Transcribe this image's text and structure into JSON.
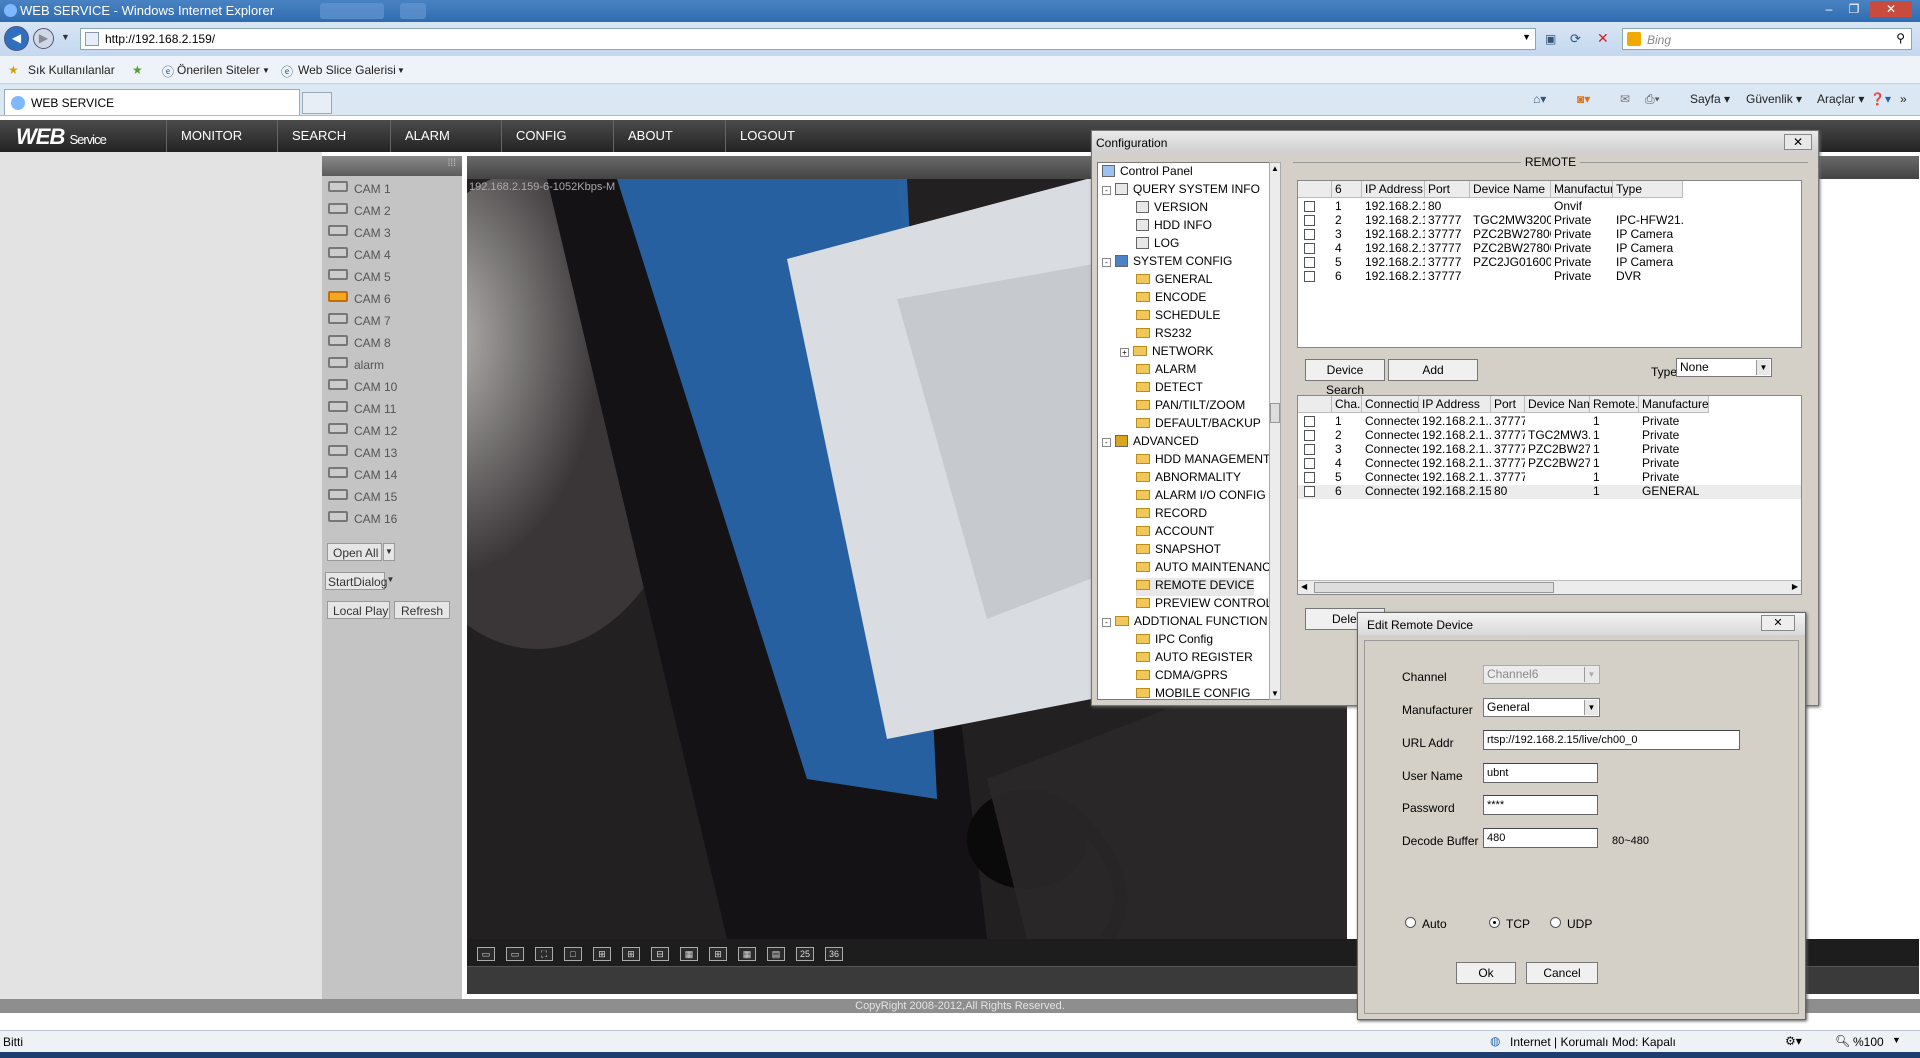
{
  "browser": {
    "window_title": "WEB SERVICE - Windows Internet Explorer",
    "address": "http://192.168.2.159/",
    "search_placeholder": "Bing",
    "favorites": [
      "Sık Kullanılanlar",
      "Önerilen Siteler",
      "Web Slice Galerisi"
    ],
    "tab_title": "WEB SERVICE",
    "commands": [
      "Sayfa",
      "Güvenlik",
      "Araçlar"
    ],
    "status_left": "Bitti",
    "status_zone": "Internet | Korumalı Mod: Kapalı",
    "zoom": "%100"
  },
  "app": {
    "logo_main": "WEB",
    "logo_sub": "Service",
    "nav": [
      "MONITOR",
      "SEARCH",
      "ALARM",
      "CONFIG",
      "ABOUT",
      "LOGOUT"
    ],
    "cameras": [
      "CAM 1",
      "CAM 2",
      "CAM 3",
      "CAM 4",
      "CAM 5",
      "CAM 6",
      "CAM 7",
      "CAM 8",
      "alarm",
      "CAM 10",
      "CAM 11",
      "CAM 12",
      "CAM 13",
      "CAM 14",
      "CAM 15",
      "CAM 16"
    ],
    "active_camera": "CAM 6",
    "buttons": {
      "open_all": "Open All",
      "start_dialog": "StartDialog",
      "local_play": "Local Play",
      "refresh": "Refresh"
    },
    "video_label": "192.168.2.159-6-1052Kbps-M",
    "layout_buttons": [
      "25",
      "36"
    ],
    "copyright": "CopyRight 2008-2012,All Rights Reserved."
  },
  "config": {
    "title": "Configuration",
    "close": "✕",
    "tree": [
      {
        "label": "Control Panel",
        "level": 0,
        "icon": "monitor-icon"
      },
      {
        "label": "QUERY SYSTEM INFO",
        "level": 1,
        "icon": "check-doc-icon",
        "expander": "-"
      },
      {
        "label": "VERSION",
        "level": 2,
        "icon": "check-doc-icon"
      },
      {
        "label": "HDD INFO",
        "level": 2,
        "icon": "check-doc-icon"
      },
      {
        "label": "LOG",
        "level": 2,
        "icon": "check-doc-icon"
      },
      {
        "label": "SYSTEM CONFIG",
        "level": 1,
        "icon": "settings-icon",
        "expander": "-"
      },
      {
        "label": "GENERAL",
        "level": 2,
        "icon": "folder-icon"
      },
      {
        "label": "ENCODE",
        "level": 2,
        "icon": "folder-icon"
      },
      {
        "label": "SCHEDULE",
        "level": 2,
        "icon": "folder-icon"
      },
      {
        "label": "RS232",
        "level": 2,
        "icon": "folder-icon"
      },
      {
        "label": "NETWORK",
        "level": 2,
        "icon": "folder-icon",
        "expander": "+"
      },
      {
        "label": "ALARM",
        "level": 2,
        "icon": "folder-icon"
      },
      {
        "label": "DETECT",
        "level": 2,
        "icon": "folder-icon"
      },
      {
        "label": "PAN/TILT/ZOOM",
        "level": 2,
        "icon": "folder-icon"
      },
      {
        "label": "DEFAULT/BACKUP",
        "level": 2,
        "icon": "folder-icon"
      },
      {
        "label": "ADVANCED",
        "level": 1,
        "icon": "gears-icon",
        "expander": "-"
      },
      {
        "label": "HDD MANAGEMENT",
        "level": 2,
        "icon": "folder-icon"
      },
      {
        "label": "ABNORMALITY",
        "level": 2,
        "icon": "folder-icon"
      },
      {
        "label": "ALARM I/O CONFIG",
        "level": 2,
        "icon": "folder-icon"
      },
      {
        "label": "RECORD",
        "level": 2,
        "icon": "folder-icon"
      },
      {
        "label": "ACCOUNT",
        "level": 2,
        "icon": "folder-icon"
      },
      {
        "label": "SNAPSHOT",
        "level": 2,
        "icon": "folder-icon"
      },
      {
        "label": "AUTO MAINTENANCE",
        "level": 2,
        "icon": "folder-icon"
      },
      {
        "label": "REMOTE DEVICE",
        "level": 2,
        "icon": "folder-icon",
        "selected": true
      },
      {
        "label": "PREVIEW CONTROL",
        "level": 2,
        "icon": "folder-icon"
      },
      {
        "label": "ADDTIONAL FUNCTION",
        "level": 1,
        "icon": "folder-icon",
        "expander": "-"
      },
      {
        "label": "IPC Config",
        "level": 2,
        "icon": "folder-icon"
      },
      {
        "label": "AUTO REGISTER",
        "level": 2,
        "icon": "folder-icon"
      },
      {
        "label": "CDMA/GPRS",
        "level": 2,
        "icon": "folder-icon"
      },
      {
        "label": "MOBILE CONFIG",
        "level": 2,
        "icon": "folder-icon"
      }
    ],
    "remote_title": "REMOTE",
    "search_table": {
      "headers": [
        "6",
        "IP Address",
        "Port",
        "Device Name",
        "Manufacturer",
        "Type"
      ],
      "rows": [
        [
          "1",
          "192.168.2.1...",
          "80",
          "",
          "Onvif",
          ""
        ],
        [
          "2",
          "192.168.2.1...",
          "37777",
          "TGC2MW32000...",
          "Private",
          "IPC-HFW21..."
        ],
        [
          "3",
          "192.168.2.1...",
          "37777",
          "PZC2BW27800...",
          "Private",
          "IP Camera"
        ],
        [
          "4",
          "192.168.2.1...",
          "37777",
          "PZC2BW27800...",
          "Private",
          "IP Camera"
        ],
        [
          "5",
          "192.168.2.1...",
          "37777",
          "PZC2JG01600080",
          "Private",
          "IP Camera"
        ],
        [
          "6",
          "192.168.2.1...",
          "37777",
          "",
          "Private",
          "DVR"
        ]
      ]
    },
    "device_search": "Device Search",
    "add": "Add",
    "type_label": "Type",
    "type_value": "None",
    "added_table": {
      "headers": [
        "Cha...",
        "Connectio...",
        "IP Address",
        "Port",
        "Device Name",
        "Remote...",
        "Manufacturer"
      ],
      "rows": [
        [
          "1",
          "Connected",
          "192.168.2.1...",
          "37777",
          "",
          "1",
          "Private"
        ],
        [
          "2",
          "Connected",
          "192.168.2.1...",
          "37777",
          "TGC2MW3...",
          "1",
          "Private"
        ],
        [
          "3",
          "Connected",
          "192.168.2.1...",
          "37777",
          "PZC2BW27...",
          "1",
          "Private"
        ],
        [
          "4",
          "Connected",
          "192.168.2.1...",
          "37777",
          "PZC2BW27...",
          "1",
          "Private"
        ],
        [
          "5",
          "Connected",
          "192.168.2.1...",
          "37777",
          "",
          "1",
          "Private"
        ],
        [
          "6",
          "Connected",
          "192.168.2.15",
          "80",
          "",
          "1",
          "GENERAL"
        ]
      ]
    },
    "delete_partial": "Dele"
  },
  "edit": {
    "title": "Edit Remote Device",
    "close": "✕",
    "channel_label": "Channel",
    "channel_value": "Channel6",
    "manufacturer_label": "Manufacturer",
    "manufacturer_value": "General",
    "url_label": "URL Addr",
    "url_value": "rtsp://192.168.2.15/live/ch00_0",
    "user_label": "User Name",
    "user_value": "ubnt",
    "password_label": "Password",
    "password_value": "****",
    "buffer_label": "Decode Buffer",
    "buffer_value": "480",
    "buffer_range": "80~480",
    "radio_auto": "Auto",
    "radio_tcp": "TCP",
    "radio_udp": "UDP",
    "selected_protocol": "TCP",
    "ok": "Ok",
    "cancel": "Cancel"
  }
}
